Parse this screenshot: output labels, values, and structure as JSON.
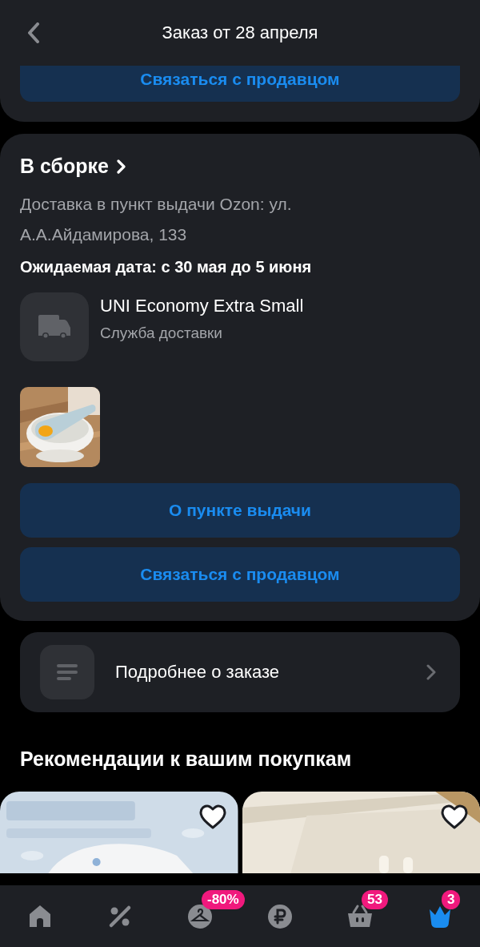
{
  "header": {
    "title": "Заказ от 28 апреля"
  },
  "previous_shipment": {
    "contact_button": "Связаться с продавцом"
  },
  "shipment": {
    "status": "В сборке",
    "address": "Доставка в пункт выдачи Ozon: ул. А.А.Айдамирова, 133",
    "expected_date": "Ожидаемая дата: с 30 мая до 5 июня",
    "carrier": {
      "name": "UNI Economy Extra Small",
      "caption": "Служба доставки"
    },
    "buttons": [
      "О пункте выдачи",
      "Связаться с продавцом"
    ]
  },
  "details_link": {
    "label": "Подробнее о заказе"
  },
  "recommendations": {
    "title": "Рекомендации к вашим покупкам"
  },
  "tab_bar": [
    {
      "kind": "home",
      "selected": false
    },
    {
      "kind": "percent",
      "selected": false
    },
    {
      "kind": "hanger",
      "selected": false,
      "badge": "-80%"
    },
    {
      "kind": "ruble",
      "selected": false
    },
    {
      "kind": "basket",
      "selected": false,
      "badge": "53"
    },
    {
      "kind": "crown",
      "selected": true,
      "badge": "3"
    }
  ]
}
